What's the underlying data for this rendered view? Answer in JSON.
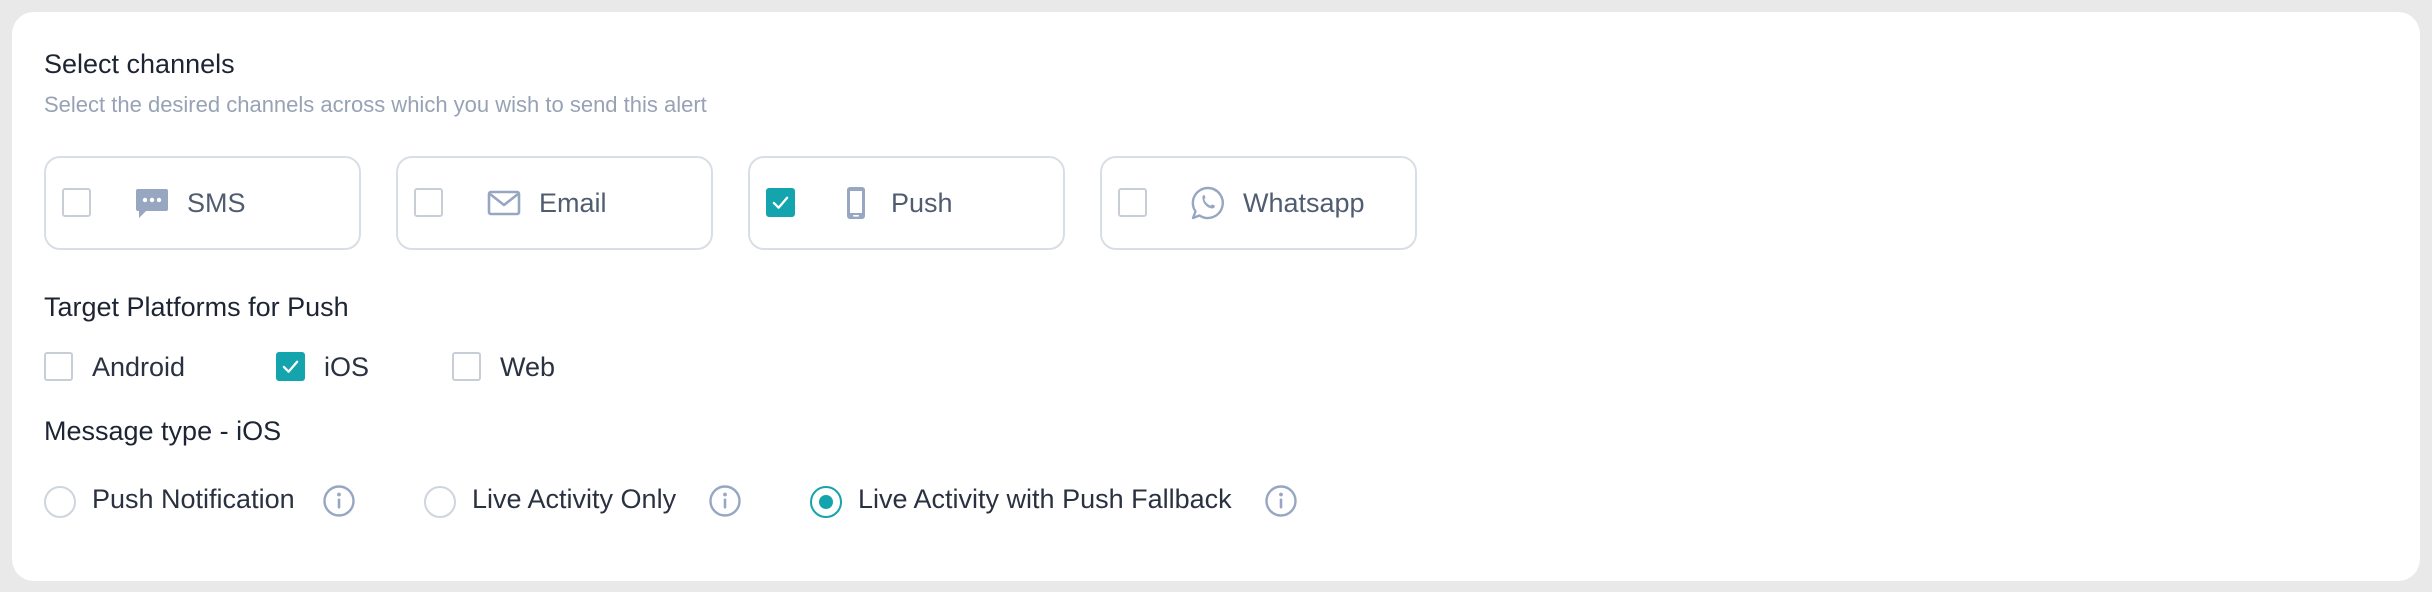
{
  "channels_section": {
    "title": "Select channels",
    "subtitle": "Select the desired channels across which you wish to send this alert"
  },
  "channels": [
    {
      "label": "SMS",
      "icon": "sms-message-icon",
      "checked": false
    },
    {
      "label": "Email",
      "icon": "envelope-icon",
      "checked": false
    },
    {
      "label": "Push",
      "icon": "mobile-phone-icon",
      "checked": true
    },
    {
      "label": "Whatsapp",
      "icon": "whatsapp-icon",
      "checked": false
    }
  ],
  "platforms_section": {
    "title": "Target Platforms for Push"
  },
  "platforms": [
    {
      "label": "Android",
      "checked": false
    },
    {
      "label": "iOS",
      "checked": true
    },
    {
      "label": "Web",
      "checked": false
    }
  ],
  "message_type_section": {
    "title": "Message type - iOS"
  },
  "message_types": [
    {
      "label": "Push Notification",
      "selected": false,
      "info_icon": "info-icon"
    },
    {
      "label": "Live Activity Only",
      "selected": false,
      "info_icon": "info-icon"
    },
    {
      "label": "Live Activity with Push Fallback",
      "selected": true,
      "info_icon": "info-icon"
    }
  ],
  "colors": {
    "accent": "#13a4ad",
    "icon": "#97a7c2",
    "border": "#d9dee6"
  }
}
